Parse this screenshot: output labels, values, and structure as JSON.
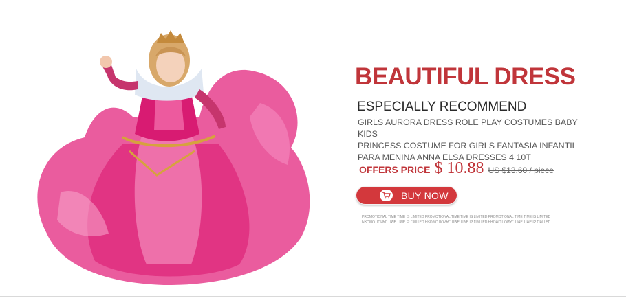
{
  "headline": "BEAUTIFUL DRESS",
  "subheading": "ESPECIALLY RECOMMEND",
  "description": "GIRLS AURORA DRESS ROLE PLAY COSTUMES BABY KIDS\n PRINCESS COSTUME FOR GIRLS FANTASIA INFANTIL\n PARA MENINA ANNA ELSA DRESSES 4 10T",
  "price": {
    "label": "OFFERS PRICE",
    "current": "$ 10.88",
    "original": "US $13.60 / piece"
  },
  "buy_button": {
    "label": "BUY NOW",
    "icon": "cart-icon"
  },
  "promo_text": "PROMOTIONAL TIME  TIME IS LIMITED  PROMOTIONAL TIME  TIME IS LIMITED  PROMOTIONAL TIME  TIME IS LIMITED",
  "image": {
    "subject": "product-photo-pink-dress",
    "icon": "dress-image"
  },
  "colors": {
    "accent_red": "#c0353a",
    "button_red": "#d3383c",
    "dress_pink": "#e0307f",
    "tulle_pink": "#ef67a4"
  }
}
